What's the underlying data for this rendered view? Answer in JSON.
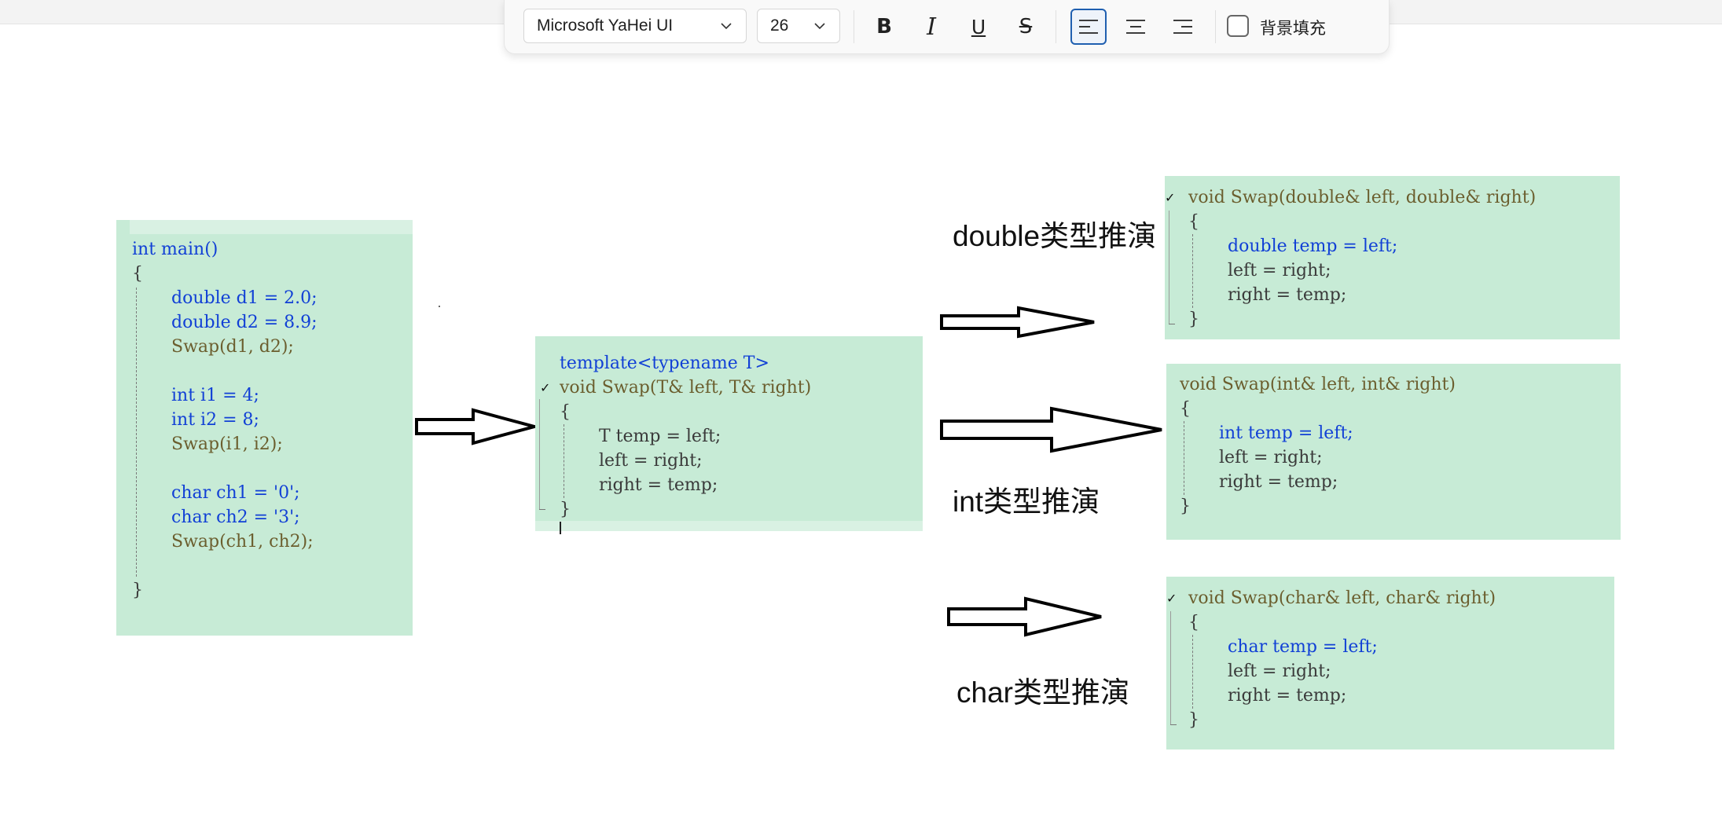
{
  "toolbar": {
    "font_family": "Microsoft YaHei UI",
    "font_size": "26",
    "bold_icon": "B",
    "italic_icon": "I",
    "underline_icon": "U",
    "strikethrough_icon": "S",
    "active_alignment": "align-left",
    "background_fill_label": "背景填充",
    "background_fill_checked": false
  },
  "main_code": {
    "lines": [
      "int main()",
      "{",
      "double d1 = 2.0;",
      "double d2 = 8.9;",
      "Swap(d1, d2);",
      "int i1 = 4;",
      "int i2 = 8;",
      "Swap(i1, i2);",
      "char ch1 = '0';",
      "char ch2 = '3';",
      "Swap(ch1, ch2);",
      "}"
    ]
  },
  "template_code": {
    "lines": [
      "template<typename T>",
      "void Swap(T& left, T& right)",
      "{",
      "T temp = left;",
      "left = right;",
      "right = temp;",
      "}"
    ]
  },
  "double_code": {
    "lines": [
      "void Swap(double& left, double& right)",
      "{",
      "double temp = left;",
      "left = right;",
      "right = temp;",
      "}"
    ]
  },
  "int_code": {
    "lines": [
      "void Swap(int& left, int& right)",
      "{",
      "int temp = left;",
      "left = right;",
      "right = temp;",
      "}"
    ]
  },
  "char_code": {
    "lines": [
      "void Swap(char& left, char& right)",
      "{",
      "char temp = left;",
      "left = right;",
      "right = temp;",
      "}"
    ]
  },
  "labels": {
    "double_deduction": "double类型推演",
    "int_deduction": "int类型推演",
    "char_deduction": "char类型推演"
  },
  "colors": {
    "code_background": "#c7ebd6",
    "keyword": "#1140d6",
    "function_name": "#6b5e2e",
    "string_literal": "#a3151a",
    "active_button_border": "#1f5fb0"
  }
}
